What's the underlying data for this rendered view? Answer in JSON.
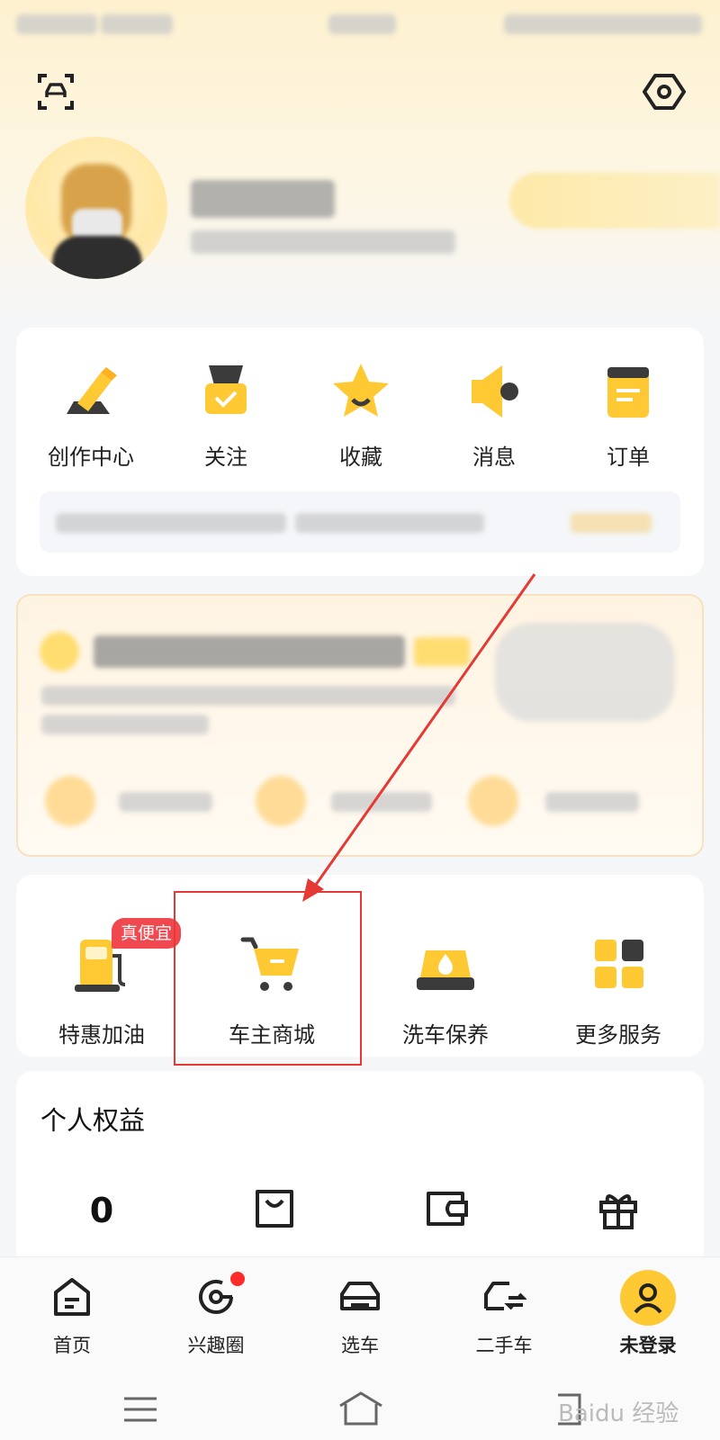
{
  "colors": {
    "accent": "#ffc933",
    "highlight": "#e53935",
    "badge": "#f0484e"
  },
  "header": {
    "scan_icon": "scan-car-icon",
    "settings_icon": "hex-settings-icon"
  },
  "quick_actions": [
    {
      "label": "创作中心",
      "icon": "pen-icon"
    },
    {
      "label": "关注",
      "icon": "follow-check-icon"
    },
    {
      "label": "收藏",
      "icon": "star-icon"
    },
    {
      "label": "消息",
      "icon": "megaphone-icon"
    },
    {
      "label": "订单",
      "icon": "order-doc-icon"
    }
  ],
  "services": [
    {
      "label": "特惠加油",
      "icon": "fuel-pump-icon",
      "badge": "真便宜"
    },
    {
      "label": "车主商城",
      "icon": "cart-icon"
    },
    {
      "label": "洗车保养",
      "icon": "car-wash-icon"
    },
    {
      "label": "更多服务",
      "icon": "grid-icon"
    }
  ],
  "benefits": {
    "title": "个人权益",
    "items": [
      {
        "value": "0"
      },
      {
        "icon": "shopping-bag-icon"
      },
      {
        "icon": "wallet-icon"
      },
      {
        "icon": "gift-icon"
      }
    ]
  },
  "tabs": [
    {
      "label": "首页",
      "icon": "home-icon"
    },
    {
      "label": "兴趣圈",
      "icon": "interest-circle-icon",
      "dot": true
    },
    {
      "label": "选车",
      "icon": "car-select-icon"
    },
    {
      "label": "二手车",
      "icon": "used-car-icon"
    },
    {
      "label": "未登录",
      "icon": "user-icon",
      "active": true
    }
  ],
  "watermark": "Baidu 经验"
}
